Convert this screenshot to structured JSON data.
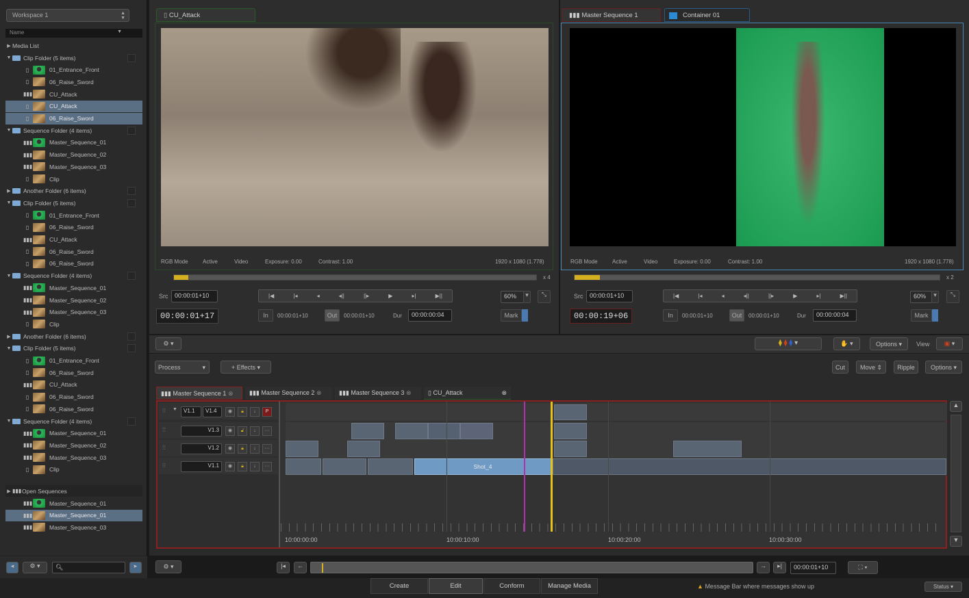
{
  "left_panel": {
    "workspace": "Workspace 1",
    "name_header": "Name",
    "media_list": "Media List",
    "tree": [
      {
        "type": "folder",
        "label": "Clip Folder (5 items)",
        "open": true
      },
      {
        "type": "clip",
        "label": "01_Entrance_Front",
        "thumb": "g",
        "icon": "clip"
      },
      {
        "type": "clip",
        "label": "06_Raise_Sword",
        "thumb": "s",
        "icon": "clip"
      },
      {
        "type": "clip",
        "label": "CU_Attack",
        "thumb": "s",
        "icon": "seq"
      },
      {
        "type": "clip",
        "label": "CU_Attack",
        "thumb": "s",
        "icon": "clip",
        "selected": true
      },
      {
        "type": "clip",
        "label": "06_Raise_Sword",
        "thumb": "s",
        "icon": "clip",
        "selected": true
      },
      {
        "type": "folder",
        "label": "Sequence Folder (4 items)",
        "open": true
      },
      {
        "type": "clip",
        "label": "Master_Sequence_01",
        "thumb": "g",
        "icon": "seq"
      },
      {
        "type": "clip",
        "label": "Master_Sequence_02",
        "thumb": "s",
        "icon": "seq"
      },
      {
        "type": "clip",
        "label": "Master_Sequence_03",
        "thumb": "s",
        "icon": "seq"
      },
      {
        "type": "clip",
        "label": "Clip",
        "thumb": "s",
        "icon": "clip"
      },
      {
        "type": "folder",
        "label": "Another Folder (6 items)",
        "open": false
      },
      {
        "type": "folder",
        "label": "Clip Folder (5 items)",
        "open": true
      },
      {
        "type": "clip",
        "label": "01_Entrance_Front",
        "thumb": "g",
        "icon": "clip"
      },
      {
        "type": "clip",
        "label": "06_Raise_Sword",
        "thumb": "s",
        "icon": "clip"
      },
      {
        "type": "clip",
        "label": "CU_Attack",
        "thumb": "s",
        "icon": "seq"
      },
      {
        "type": "clip",
        "label": "06_Raise_Sword",
        "thumb": "s",
        "icon": "clip"
      },
      {
        "type": "clip",
        "label": "06_Raise_Sword",
        "thumb": "s",
        "icon": "clip"
      },
      {
        "type": "folder",
        "label": "Sequence Folder (4 items)",
        "open": true
      },
      {
        "type": "clip",
        "label": "Master_Sequence_01",
        "thumb": "g",
        "icon": "seq"
      },
      {
        "type": "clip",
        "label": "Master_Sequence_02",
        "thumb": "s",
        "icon": "seq"
      },
      {
        "type": "clip",
        "label": "Master_Sequence_03",
        "thumb": "s",
        "icon": "seq"
      },
      {
        "type": "clip",
        "label": "Clip",
        "thumb": "s",
        "icon": "clip"
      },
      {
        "type": "folder",
        "label": "Another Folder (6 items)",
        "open": false
      },
      {
        "type": "folder",
        "label": "Clip Folder (5 items)",
        "open": true
      },
      {
        "type": "clip",
        "label": "01_Entrance_Front",
        "thumb": "g",
        "icon": "clip"
      },
      {
        "type": "clip",
        "label": "06_Raise_Sword",
        "thumb": "s",
        "icon": "clip"
      },
      {
        "type": "clip",
        "label": "CU_Attack",
        "thumb": "s",
        "icon": "seq"
      },
      {
        "type": "clip",
        "label": "06_Raise_Sword",
        "thumb": "s",
        "icon": "clip"
      },
      {
        "type": "clip",
        "label": "06_Raise_Sword",
        "thumb": "s",
        "icon": "clip"
      },
      {
        "type": "folder",
        "label": "Sequence Folder (4 items)",
        "open": true
      },
      {
        "type": "clip",
        "label": "Master_Sequence_01",
        "thumb": "g",
        "icon": "seq"
      },
      {
        "type": "clip",
        "label": "Master_Sequence_02",
        "thumb": "s",
        "icon": "seq"
      },
      {
        "type": "clip",
        "label": "Master_Sequence_03",
        "thumb": "s",
        "icon": "seq"
      },
      {
        "type": "clip",
        "label": "Clip",
        "thumb": "s",
        "icon": "clip"
      }
    ],
    "open_sequences": {
      "label": "Open Sequences",
      "items": [
        {
          "label": "Master_Sequence_01",
          "thumb": "g"
        },
        {
          "label": "Master_Sequence_01",
          "thumb": "s",
          "selected": true
        },
        {
          "label": "Master_Sequence_03",
          "thumb": "s"
        }
      ]
    }
  },
  "source_viewer": {
    "tab": "CU_Attack",
    "info": {
      "mode": "RGB Mode",
      "active": "Active",
      "video": "Video",
      "exposure": "Exposure: 0.00",
      "contrast": "Contrast: 1.00",
      "resolution": "1920 x 1080 (1.778)"
    },
    "speed": "x 4",
    "progress": 0.04,
    "src_label": "Src",
    "src_tc": "00:00:01+10",
    "current_tc": "00:00:01+17",
    "in_label": "In",
    "in_tc": "00:00:01+10",
    "out_label": "Out",
    "out_tc": "00:00:01+10",
    "dur_label": "Dur",
    "dur_tc": "00:00:00:04",
    "zoom": "60%",
    "mark": "Mark"
  },
  "record_viewer": {
    "tab1": "Master Sequence 1",
    "tab2": "Container 01",
    "info": {
      "mode": "RGB Mode",
      "active": "Active",
      "video": "Video",
      "exposure": "Exposure: 0.00",
      "contrast": "Contrast: 1.00",
      "resolution": "1920 x 1080 (1.778)"
    },
    "speed": "x 2",
    "progress": 0.07,
    "src_label": "Src",
    "src_tc": "00:00:01+10",
    "current_tc": "00:00:19+06",
    "in_label": "In",
    "in_tc": "00:00:01+10",
    "out_label": "Out",
    "out_tc": "00:00:01+10",
    "dur_label": "Dur",
    "dur_tc": "00:00:00:04",
    "zoom": "60%",
    "mark": "Mark"
  },
  "toolbar": {
    "options1": "Options",
    "view": "View",
    "options2": "Options"
  },
  "timeline": {
    "process": "Process",
    "effects": "Effects",
    "cut": "Cut",
    "move": "Move",
    "ripple": "Ripple",
    "options": "Options",
    "tabs": [
      "Master Sequence 1",
      "Master Sequence 2",
      "Master Sequence 3",
      "CU_Attack"
    ],
    "tracks": [
      {
        "src": "V1.1",
        "dst": "V1.4",
        "p": "P"
      },
      {
        "src": "",
        "dst": "V1.3"
      },
      {
        "src": "",
        "dst": "V1.2"
      },
      {
        "src": "",
        "dst": "V1.1"
      }
    ],
    "shot_label": "Shot_4",
    "ruler": [
      "10:00:00:00",
      "10:00:10:00",
      "10:00:20:00",
      "10:00:30:00"
    ],
    "bottom_tc": "00:00:01+10"
  },
  "bottom": {
    "tabs": [
      "Create",
      "Edit",
      "Conform",
      "Manage Media"
    ],
    "message": "Message Bar where messages show up",
    "status": "Status"
  },
  "colors": {
    "accent_yellow": "#d4b020",
    "selection": "#5a6e84",
    "record_border": "#8a2020",
    "playhead": "#e6c21a",
    "marker": "#b030b0"
  }
}
